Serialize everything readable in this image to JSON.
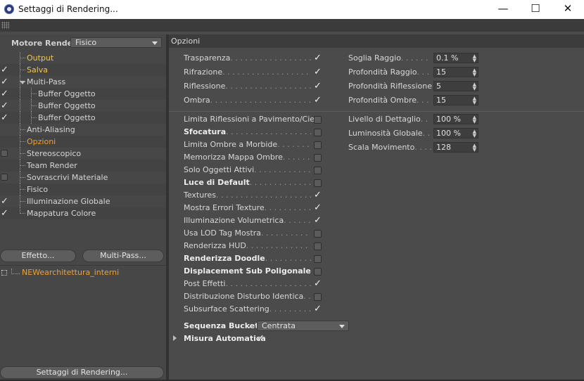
{
  "window": {
    "title": "Settaggi di Rendering...",
    "minimize": "—",
    "maximize": "☐",
    "close": "✕"
  },
  "render_engine": {
    "label": "Motore Render",
    "value": "Fisico"
  },
  "tree": [
    {
      "label": "Output",
      "check": "none",
      "style": "hl"
    },
    {
      "label": "Salva",
      "check": "tick",
      "style": "hl"
    },
    {
      "label": "Multi-Pass",
      "check": "tick",
      "style": "normal"
    },
    {
      "label": "Buffer Oggetto",
      "check": "tick",
      "style": "normal"
    },
    {
      "label": "Buffer Oggetto",
      "check": "tick",
      "style": "normal"
    },
    {
      "label": "Buffer Oggetto",
      "check": "tick",
      "style": "normal"
    },
    {
      "label": "Anti-Aliasing",
      "check": "none",
      "style": "normal"
    },
    {
      "label": "Opzioni",
      "check": "none",
      "style": "sel"
    },
    {
      "label": "Stereoscopico",
      "check": "box",
      "style": "normal"
    },
    {
      "label": "Team Render",
      "check": "none",
      "style": "normal"
    },
    {
      "label": "Sovrascrivi Materiale",
      "check": "box",
      "style": "normal"
    },
    {
      "label": "Fisico",
      "check": "none",
      "style": "normal"
    },
    {
      "label": "Illuminazione Globale",
      "check": "tick",
      "style": "normal"
    },
    {
      "label": "Mappatura Colore",
      "check": "tick",
      "style": "normal"
    }
  ],
  "buttons": {
    "effect": "Effetto...",
    "multipass": "Multi-Pass..."
  },
  "preset": {
    "name": "NEWearchitettura_interni"
  },
  "footer_button": "Settaggi di Rendering...",
  "options": {
    "header": "Opzioni",
    "top_left": [
      {
        "label": "Trasparenza",
        "checked": true
      },
      {
        "label": "Rifrazione",
        "checked": true
      },
      {
        "label": "Riflessione",
        "checked": true
      },
      {
        "label": "Ombra",
        "checked": true
      }
    ],
    "top_right": [
      {
        "label": "Soglia Raggio",
        "value": "0.1 %"
      },
      {
        "label": "Profondità Raggio",
        "value": "15"
      },
      {
        "label": "Profondità Riflessione",
        "value": "5"
      },
      {
        "label": "Profondità Ombre",
        "value": "15"
      }
    ],
    "main": [
      {
        "label": "Limita Riflessioni a Pavimento/Cielo",
        "checked": false,
        "bold": false
      },
      {
        "label": "Sfocatura",
        "checked": false,
        "bold": true
      },
      {
        "label": "Limita Ombre a Morbide",
        "checked": false,
        "bold": false
      },
      {
        "label": "Memorizza Mappa Ombre",
        "checked": false,
        "bold": false
      },
      {
        "label": "Solo Oggetti Attivi",
        "checked": false,
        "bold": false
      },
      {
        "label": "Luce di Default",
        "checked": false,
        "bold": true
      },
      {
        "label": "Textures",
        "checked": true,
        "bold": false
      },
      {
        "label": "Mostra Errori Texture",
        "checked": true,
        "bold": false
      },
      {
        "label": "Illuminazione Volumetrica",
        "checked": true,
        "bold": false
      },
      {
        "label": "Usa LOD Tag Mostra",
        "checked": false,
        "bold": false
      },
      {
        "label": "Renderizza HUD",
        "checked": false,
        "bold": false
      },
      {
        "label": "Renderizza Doodle",
        "checked": false,
        "bold": true
      },
      {
        "label": "Displacement Sub Poligonale",
        "checked": false,
        "bold": true
      },
      {
        "label": "Post Effetti",
        "checked": true,
        "bold": false
      },
      {
        "label": "Distribuzione Disturbo Identica",
        "checked": false,
        "bold": false
      },
      {
        "label": "Subsurface Scattering",
        "checked": true,
        "bold": false
      }
    ],
    "mid_right": [
      {
        "label": "Livello di Dettaglio",
        "value": "100 %"
      },
      {
        "label": "Luminosità Globale",
        "value": "100 %"
      },
      {
        "label": "Scala Movimento",
        "value": "128"
      }
    ],
    "bucket": {
      "label": "Sequenza Bucket",
      "value": "Centrata"
    },
    "auto_size": {
      "label": "Misura Automatica",
      "checked": true
    }
  },
  "tick_char": "✓"
}
